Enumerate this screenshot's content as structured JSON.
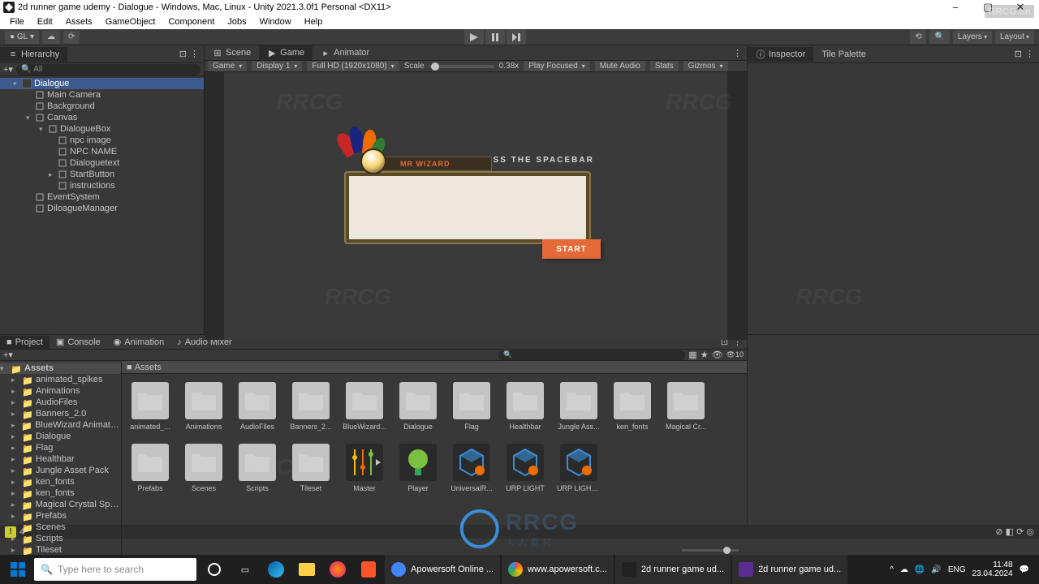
{
  "title": "2d runner game udemy - Dialogue - Windows, Mac, Linux - Unity 2021.3.0f1 Personal <DX11>",
  "menu": [
    "File",
    "Edit",
    "Assets",
    "GameObject",
    "Component",
    "Jobs",
    "Window",
    "Help"
  ],
  "toolbar": {
    "gl": "GL",
    "layers": "Layers",
    "layout": "Layout"
  },
  "hierarchy": {
    "title": "Hierarchy",
    "search_placeholder": "All",
    "items": [
      {
        "label": "Dialogue",
        "depth": 1,
        "sel": true,
        "expand": "▾",
        "scene": true
      },
      {
        "label": "Main Camera",
        "depth": 2
      },
      {
        "label": "Background",
        "depth": 2
      },
      {
        "label": "Canvas",
        "depth": 2,
        "expand": "▾"
      },
      {
        "label": "DialogueBox",
        "depth": 3,
        "expand": "▾"
      },
      {
        "label": "npc image",
        "depth": 4
      },
      {
        "label": "NPC NAME",
        "depth": 4
      },
      {
        "label": "Dialoguetext",
        "depth": 4
      },
      {
        "label": "StartButton",
        "depth": 4,
        "expand": "▸"
      },
      {
        "label": "instructions",
        "depth": 4
      },
      {
        "label": "EventSystem",
        "depth": 2
      },
      {
        "label": "DiloagueManager",
        "depth": 2
      }
    ]
  },
  "game_tabs": {
    "scene": "Scene",
    "game": "Game",
    "animator": "Animator"
  },
  "game_toolbar": {
    "mode": "Game",
    "display": "Display 1",
    "resolution": "Full HD (1920x1080)",
    "scale_label": "Scale",
    "scale_value": "0.38x",
    "play_mode": "Play Focused",
    "mute": "Mute Audio",
    "stats": "Stats",
    "gizmos": "Gizmos"
  },
  "dialogue": {
    "instr": "PRESS THE SPACEBAR",
    "npc_name": "MR WIZARD",
    "start": "START"
  },
  "inspector": {
    "title": "Inspector",
    "tilepalette": "Tile Palette"
  },
  "project": {
    "tabs": {
      "project": "Project",
      "console": "Console",
      "animation": "Animation",
      "audiomixer": "Audio Mixer"
    },
    "slider_value": "10",
    "root": "Assets",
    "breadcrumb": "Assets",
    "folders": [
      "animated_spikes",
      "Animations",
      "AudioFiles",
      "Banners_2.0",
      "BlueWizard Animations",
      "Dialogue",
      "Flag",
      "Healthbar",
      "Jungle Asset Pack",
      "ken_fonts",
      "ken_fonts",
      "Magical Crystal Sprite",
      "Prefabs",
      "Scenes",
      "Scripts",
      "Tileset"
    ],
    "assets": [
      {
        "label": "animated_...",
        "type": "folder"
      },
      {
        "label": "Animations",
        "type": "folder"
      },
      {
        "label": "AudioFiles",
        "type": "folder"
      },
      {
        "label": "Banners_2...",
        "type": "folder"
      },
      {
        "label": "BlueWizard...",
        "type": "folder"
      },
      {
        "label": "Dialogue",
        "type": "folder"
      },
      {
        "label": "Flag",
        "type": "folder"
      },
      {
        "label": "Healthbar",
        "type": "folder"
      },
      {
        "label": "Jungle Ass...",
        "type": "folder"
      },
      {
        "label": "ken_fonts",
        "type": "folder"
      },
      {
        "label": "Magical Cr...",
        "type": "folder"
      },
      {
        "label": "Prefabs",
        "type": "folder"
      },
      {
        "label": "Scenes",
        "type": "folder"
      },
      {
        "label": "Scripts",
        "type": "folder"
      },
      {
        "label": "Tileset",
        "type": "folder"
      },
      {
        "label": "Master",
        "type": "mixer"
      },
      {
        "label": "Player",
        "type": "prefab-green"
      },
      {
        "label": "UniversalR...",
        "type": "prefab-blue"
      },
      {
        "label": "URP LIGHT",
        "type": "prefab-blue"
      },
      {
        "label": "URP LIGHT...",
        "type": "prefab-blue"
      }
    ]
  },
  "statusbar": {
    "warn_count": "4"
  },
  "taskbar": {
    "search_placeholder": "Type here to search",
    "apps_wide": [
      {
        "label": "Apowersoft Online ..."
      },
      {
        "label": "www.apowersoft.c..."
      },
      {
        "label": "2d runner game ud..."
      },
      {
        "label": "2d runner game ud..."
      }
    ],
    "time": "11:48",
    "date": "23.04.2024"
  },
  "watermark": {
    "text": "RRCG",
    "url": "RRCG.cn",
    "sub": "人人素材"
  }
}
